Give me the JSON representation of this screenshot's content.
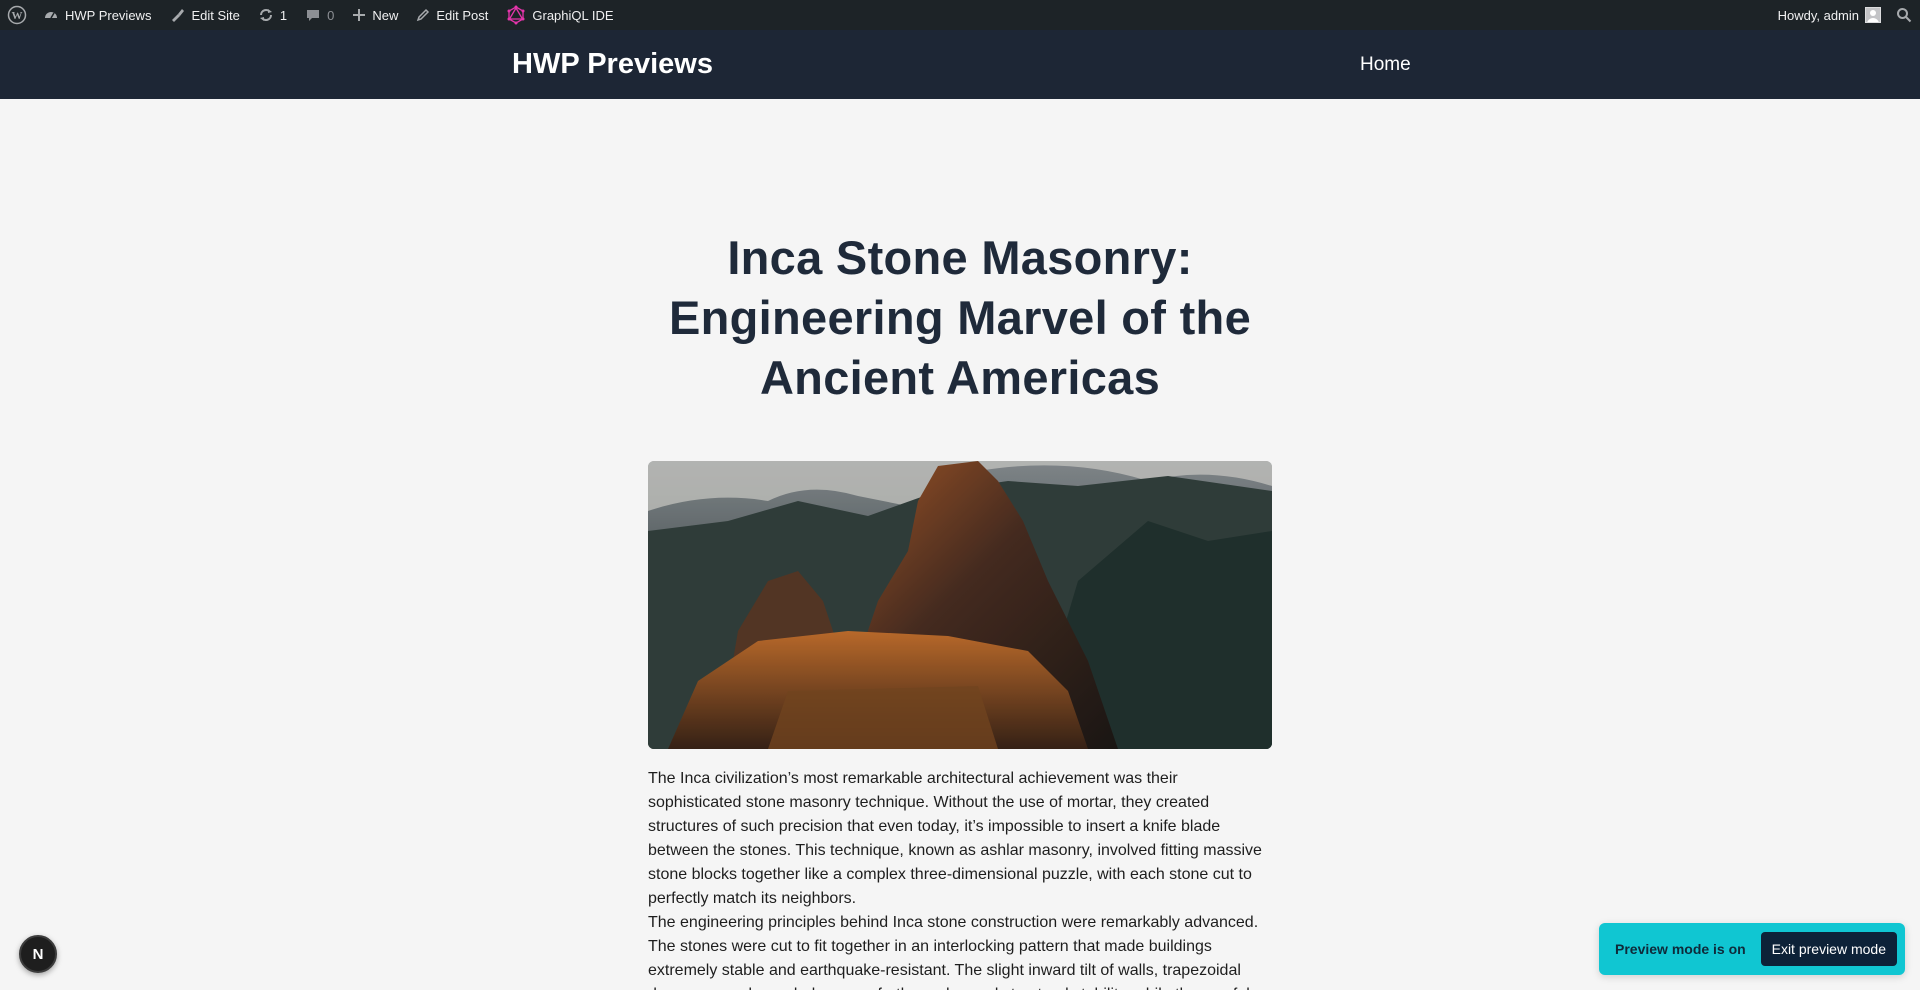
{
  "admin_bar": {
    "wp_logo_icon": "wordpress-logo-icon",
    "site_name": "HWP Previews",
    "edit_site": "Edit Site",
    "updates_count": "1",
    "comments_count": "0",
    "new_label": "New",
    "edit_post": "Edit Post",
    "graphiql": "GraphiQL IDE",
    "howdy": "Howdy, admin"
  },
  "header": {
    "site_title": "HWP Previews",
    "nav": [
      "Home"
    ]
  },
  "post": {
    "title": "Inca Stone Masonry: Engineering Marvel of the Ancient Americas",
    "paragraphs": [
      "The Inca civilization’s most remarkable architectural achievement was their sophisticated stone masonry technique. Without the use of mortar, they created structures of such precision that even today, it’s impossible to insert a knife blade between the stones. This technique, known as ashlar masonry, involved fitting massive stone blocks together like a complex three-dimensional puzzle, with each stone cut to perfectly match its neighbors.",
      "The engineering principles behind Inca stone construction were remarkably advanced. The stones were cut to fit together in an interlocking pattern that made buildings extremely stable and earthquake-resistant. The slight inward tilt of walls, trapezoidal doorways, and rounded corners further enhanced structural stability, while the careful"
    ]
  },
  "next_badge": {
    "letter": "N"
  },
  "preview": {
    "status": "Preview mode is on",
    "exit_label": "Exit preview mode"
  },
  "colors": {
    "admin_bar_bg": "#1d2327",
    "header_bg": "#1d2635",
    "page_bg": "#f5f5f5",
    "preview_bg": "#10c6d2",
    "exit_btn_bg": "#0d2238",
    "graphql_pink": "#e535ab"
  }
}
